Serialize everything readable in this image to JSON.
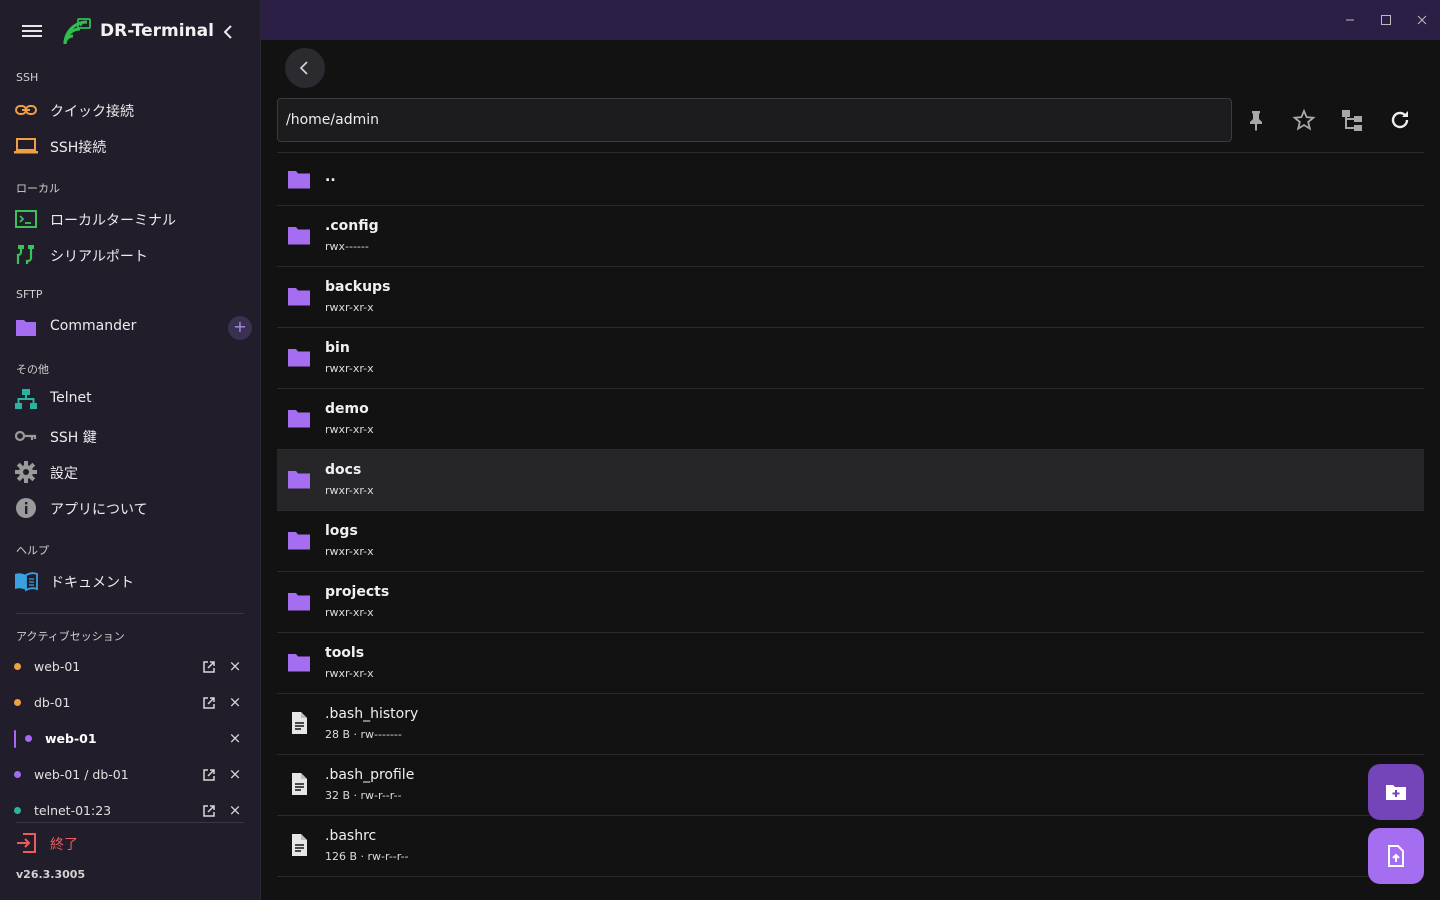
{
  "app": {
    "title": "DR-Terminal",
    "version": "v26.3.3005",
    "accent": "#a56df0"
  },
  "sidebar": {
    "sections": {
      "ssh": "SSH",
      "local": "ローカル",
      "sftp": "SFTP",
      "other": "その他",
      "help": "ヘルプ",
      "active_sessions": "アクティブセッション"
    },
    "items": {
      "quick_connect": {
        "label": "クイック接続",
        "icon": "link-icon"
      },
      "ssh_connect": {
        "label": "SSH接続",
        "icon": "laptop-icon"
      },
      "local_terminal": {
        "label": "ローカルターミナル",
        "icon": "terminal-icon"
      },
      "serial_port": {
        "label": "シリアルポート",
        "icon": "cable-icon"
      },
      "commander": {
        "label": "Commander",
        "icon": "folder-icon"
      },
      "telnet": {
        "label": "Telnet",
        "icon": "network-icon"
      },
      "ssh_keys": {
        "label": "SSH 鍵",
        "icon": "key-icon"
      },
      "settings": {
        "label": "設定",
        "icon": "gear-icon"
      },
      "about": {
        "label": "アプリについて",
        "icon": "info-icon"
      },
      "docs": {
        "label": "ドキュメント",
        "icon": "book-icon"
      }
    },
    "add_label": "+",
    "sessions": [
      {
        "name": "web-01",
        "color": "#f0a040",
        "active": false,
        "popout": true
      },
      {
        "name": "db-01",
        "color": "#f0a040",
        "active": false,
        "popout": true
      },
      {
        "name": "web-01",
        "color": "#a46bf0",
        "active": true,
        "popout": false
      },
      {
        "name": "web-01 / db-01",
        "color": "#a46bf0",
        "active": false,
        "popout": true
      },
      {
        "name": "telnet-01:23",
        "color": "#2bb3a0",
        "active": false,
        "popout": true
      }
    ],
    "close_glyph": "×",
    "quit_label": "終了"
  },
  "browser": {
    "path": "/home/admin",
    "entries": [
      {
        "name": "..",
        "meta": "",
        "type": "dir",
        "parent": true
      },
      {
        "name": ".config",
        "meta": "rwx------",
        "type": "dir"
      },
      {
        "name": "backups",
        "meta": "rwxr-xr-x",
        "type": "dir"
      },
      {
        "name": "bin",
        "meta": "rwxr-xr-x",
        "type": "dir"
      },
      {
        "name": "demo",
        "meta": "rwxr-xr-x",
        "type": "dir"
      },
      {
        "name": "docs",
        "meta": "rwxr-xr-x",
        "type": "dir",
        "selected": true
      },
      {
        "name": "logs",
        "meta": "rwxr-xr-x",
        "type": "dir"
      },
      {
        "name": "projects",
        "meta": "rwxr-xr-x",
        "type": "dir"
      },
      {
        "name": "tools",
        "meta": "rwxr-xr-x",
        "type": "dir"
      },
      {
        "name": ".bash_history",
        "meta": "28 B · rw-------",
        "type": "file"
      },
      {
        "name": ".bash_profile",
        "meta": "32 B · rw-r--r--",
        "type": "file"
      },
      {
        "name": ".bashrc",
        "meta": "126 B · rw-r--r--",
        "type": "file"
      }
    ]
  }
}
